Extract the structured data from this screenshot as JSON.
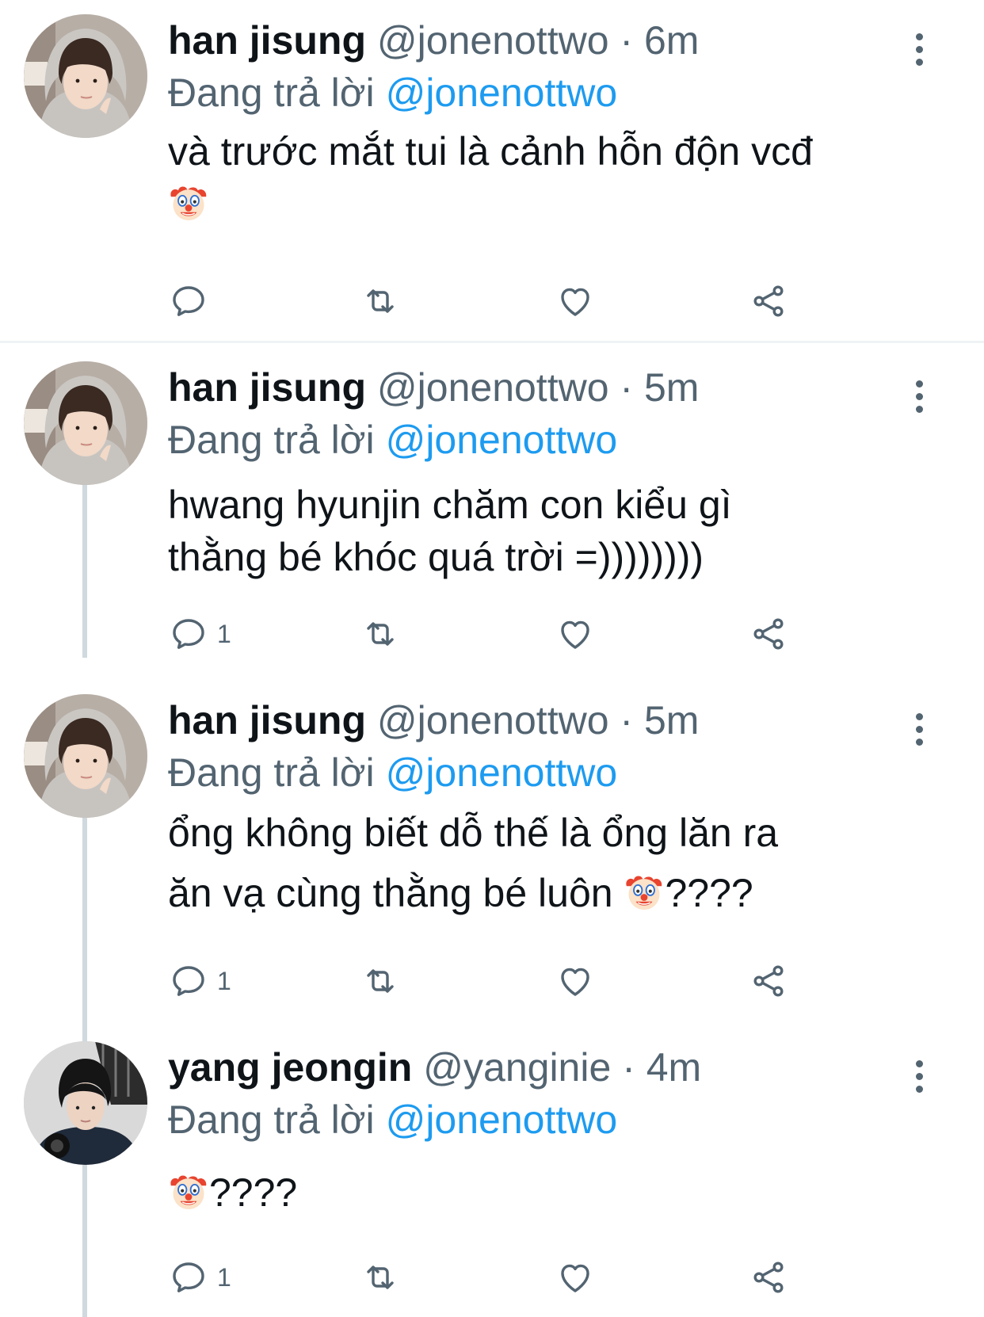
{
  "tweets": [
    {
      "name": "han jisung",
      "handle": "@jonenottwo",
      "time": "· 6m",
      "replying_prefix": "Đang trả lời ",
      "replying_to": "@jonenottwo",
      "lines": [
        "và trước mắt tui là cảnh hỗn độn vcđ",
        ""
      ],
      "emoji_line_suffix": "",
      "reply_count": ""
    },
    {
      "name": "han jisung",
      "handle": "@jonenottwo",
      "time": "· 5m",
      "replying_prefix": "Đang trả lời ",
      "replying_to": "@jonenottwo",
      "lines": [
        "hwang hyunjin chăm con kiểu gì",
        "thằng bé khóc quá trời =))))))))"
      ],
      "reply_count": "1"
    },
    {
      "name": "han jisung",
      "handle": "@jonenottwo",
      "time": "· 5m",
      "replying_prefix": "Đang trả lời ",
      "replying_to": "@jonenottwo",
      "lines": [
        "ổng không biết dỗ thế là ổng lăn ra",
        "ăn vạ cùng thằng bé luôn "
      ],
      "emoji_line_suffix": "????",
      "reply_count": "1"
    },
    {
      "name": "yang jeongin",
      "handle": "@yanginie",
      "time": "· 4m",
      "replying_prefix": "Đang trả lời ",
      "replying_to": "@jonenottwo",
      "emoji_line_suffix": "????",
      "reply_count": "1"
    }
  ],
  "icons": {
    "reply": "reply-icon",
    "retweet": "retweet-icon",
    "like": "heart-icon",
    "share": "share-icon",
    "more": "more-vertical-icon",
    "emoji": "clown-face-emoji"
  },
  "colors": {
    "text": "#0f1419",
    "secondary": "#536471",
    "link": "#1d9bf0",
    "thread_line": "#cfd9de",
    "divider": "#eff3f4"
  }
}
